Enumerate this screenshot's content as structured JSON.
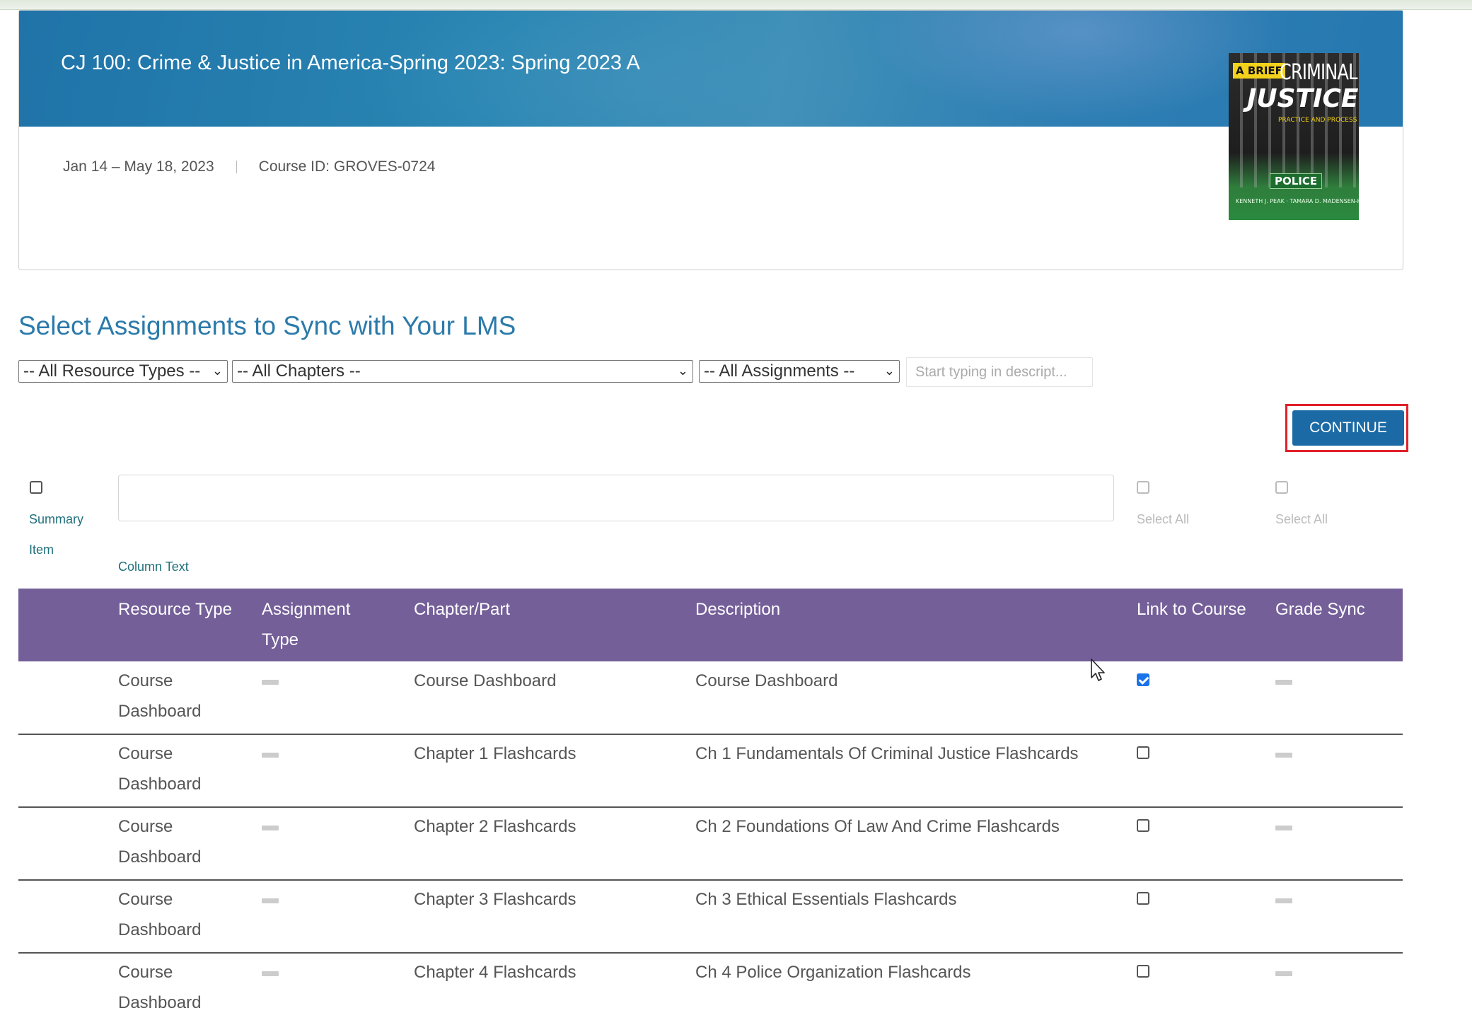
{
  "course": {
    "title": "CJ 100: Crime & Justice in America-Spring 2023: Spring 2023 A",
    "dates": "Jan 14 – May 18, 2023",
    "course_id": "Course ID: GROVES-0724"
  },
  "book": {
    "badge": "A BRIEF",
    "title_line1": "CRIMINAL",
    "title_line2": "JUSTICE",
    "tagline": "PRACTICE AND PROCESS",
    "police": "POLICE",
    "authors": "KENNETH J. PEAK · TAMARA D. MADENSEN-HEROLD"
  },
  "section_title": "Select Assignments to Sync with Your LMS",
  "filters": {
    "resource_types": "-- All Resource Types --",
    "chapters": "-- All Chapters --",
    "assignments": "-- All Assignments --",
    "search_placeholder": "Start typing in descript..."
  },
  "continue_label": "CONTINUE",
  "options": {
    "summary_item_line1": "Summary",
    "summary_item_line2": "Item",
    "column_text": "Column Text",
    "link_select_all": "Select All",
    "grade_select_all": "Select All"
  },
  "table": {
    "headers": {
      "resource_type": "Resource Type",
      "assignment_type_line1": "Assignment",
      "assignment_type_line2": "Type",
      "chapter_part": "Chapter/Part",
      "description": "Description",
      "link_to_course": "Link to Course",
      "grade_sync": "Grade Sync"
    },
    "rows": [
      {
        "resource_line1": "Course",
        "resource_line2": "Dashboard",
        "chapter": "Course Dashboard",
        "description": "Course Dashboard",
        "linked": true
      },
      {
        "resource_line1": "Course",
        "resource_line2": "Dashboard",
        "chapter": "Chapter 1 Flashcards",
        "description": "Ch 1 Fundamentals Of Criminal Justice Flashcards",
        "linked": false
      },
      {
        "resource_line1": "Course",
        "resource_line2": "Dashboard",
        "chapter": "Chapter 2 Flashcards",
        "description": "Ch 2 Foundations Of Law And Crime Flashcards",
        "linked": false
      },
      {
        "resource_line1": "Course",
        "resource_line2": "Dashboard",
        "chapter": "Chapter 3 Flashcards",
        "description": "Ch 3 Ethical Essentials Flashcards",
        "linked": false
      },
      {
        "resource_line1": "Course",
        "resource_line2": "Dashboard",
        "chapter": "Chapter 4 Flashcards",
        "description": "Ch 4 Police Organization Flashcards",
        "linked": false
      }
    ]
  },
  "colors": {
    "banner": "#2a86b3",
    "heading": "#2b7aaa",
    "table_header": "#745f99",
    "continue_button": "#1b6aa5",
    "highlight": "#e0202b",
    "checkbox_checked": "#1a73e8"
  }
}
